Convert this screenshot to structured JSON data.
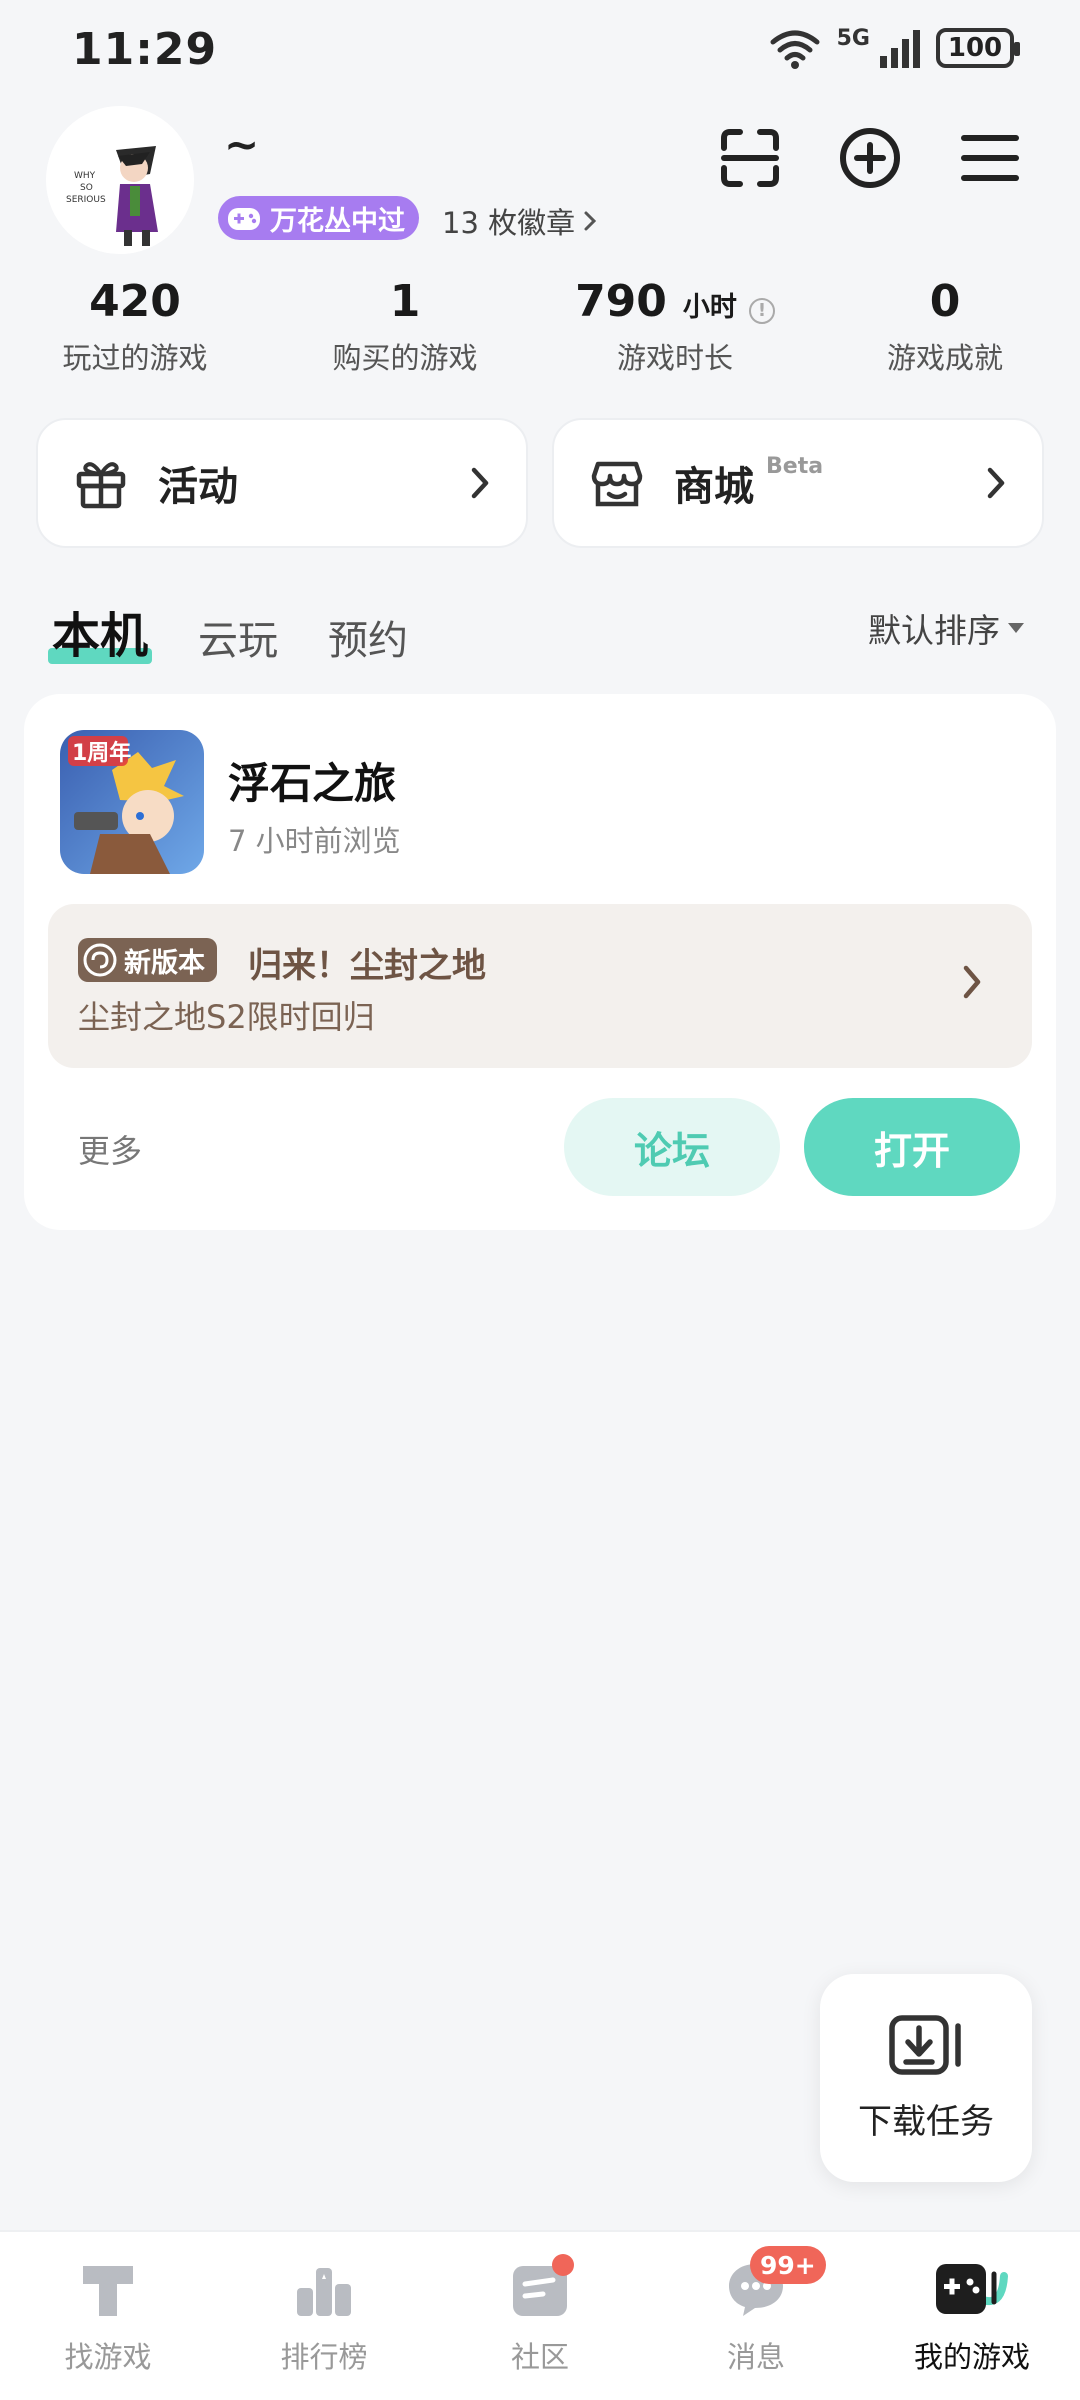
{
  "status_bar": {
    "time": "11:29",
    "network_label": "5G",
    "battery": "100"
  },
  "profile": {
    "nickname": "~",
    "title_badge": "万花丛中过",
    "badges_count": "13 枚徽章",
    "avatar_icon": "character-avatar"
  },
  "header_actions": [
    {
      "name": "scan-icon"
    },
    {
      "name": "add-circle-icon"
    },
    {
      "name": "menu-icon"
    }
  ],
  "stats": [
    {
      "value": "420",
      "label": "玩过的游戏"
    },
    {
      "value": "1",
      "label": "购买的游戏"
    },
    {
      "value": "790",
      "unit": "小时",
      "label": "游戏时长"
    },
    {
      "value": "0",
      "label": "游戏成就"
    }
  ],
  "quick_cards": {
    "activity": {
      "label": "活动",
      "icon": "gift-icon"
    },
    "store": {
      "label": "商城",
      "beta": "Beta",
      "icon": "store-icon"
    }
  },
  "tabs": [
    {
      "label": "本机",
      "active": true
    },
    {
      "label": "云玩",
      "active": false
    },
    {
      "label": "预约",
      "active": false
    }
  ],
  "sort": {
    "label": "默认排序"
  },
  "game": {
    "name": "浮石之旅",
    "last_viewed": "7 小时前浏览",
    "icon_text": "1周年",
    "news_tag": "新版本",
    "news_title": "归来！尘封之地",
    "news_subtitle": "尘封之地S2限时回归",
    "more_label": "更多",
    "forum_button": "论坛",
    "open_button": "打开"
  },
  "download_task": {
    "label": "下载任务"
  },
  "bottom_nav": [
    {
      "label": "找游戏",
      "icon": "find-game-icon",
      "active": false
    },
    {
      "label": "排行榜",
      "icon": "ranking-icon",
      "active": false
    },
    {
      "label": "社区",
      "icon": "community-icon",
      "active": false,
      "dot": true
    },
    {
      "label": "消息",
      "icon": "message-icon",
      "active": false,
      "badge": "99+"
    },
    {
      "label": "我的游戏",
      "icon": "my-games-icon",
      "active": true
    }
  ],
  "colors": {
    "accent": "#5fd8c0",
    "badge_purple": "#a77cf0",
    "news_brown": "#7b6353",
    "alert_red": "#f06659",
    "background": "#f5f6f8"
  }
}
